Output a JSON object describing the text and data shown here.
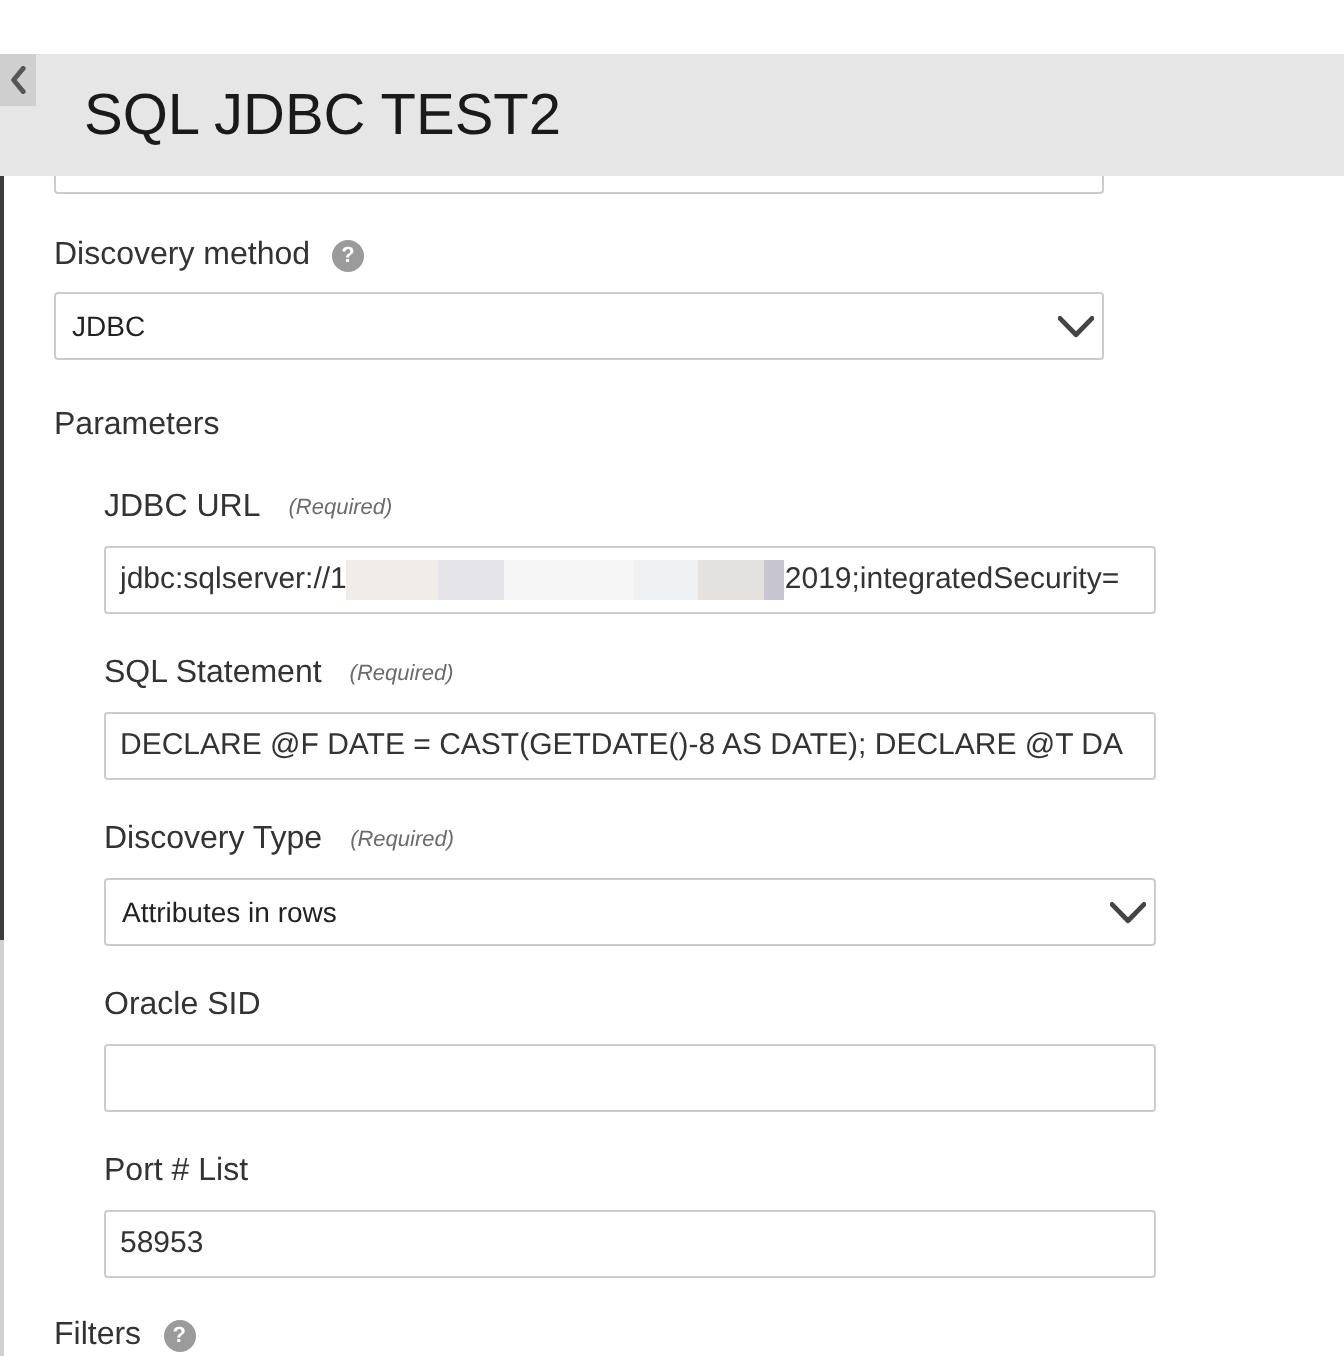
{
  "header": {
    "title": "SQL JDBC TEST2"
  },
  "discovery_method": {
    "label": "Discovery method",
    "help": "?",
    "value": "JDBC"
  },
  "parameters": {
    "label": "Parameters",
    "fields": [
      {
        "kind": "text",
        "label": "JDBC URL",
        "note": "(Required)",
        "value": "jdbc:sqlserver://1",
        "redacted": true,
        "value_after": "2019;integratedSecurity="
      },
      {
        "kind": "text",
        "label": "SQL Statement",
        "note": "(Required)",
        "value": "DECLARE @F DATE = CAST(GETDATE()-8 AS DATE); DECLARE @T DA"
      },
      {
        "kind": "select",
        "label": "Discovery Type",
        "note": "(Required)",
        "value": "Attributes in rows"
      },
      {
        "kind": "text",
        "label": "Oracle SID"
      },
      {
        "kind": "text",
        "label": "Port # List",
        "value": "58953"
      }
    ]
  },
  "filters": {
    "label": "Filters",
    "help": "?"
  }
}
